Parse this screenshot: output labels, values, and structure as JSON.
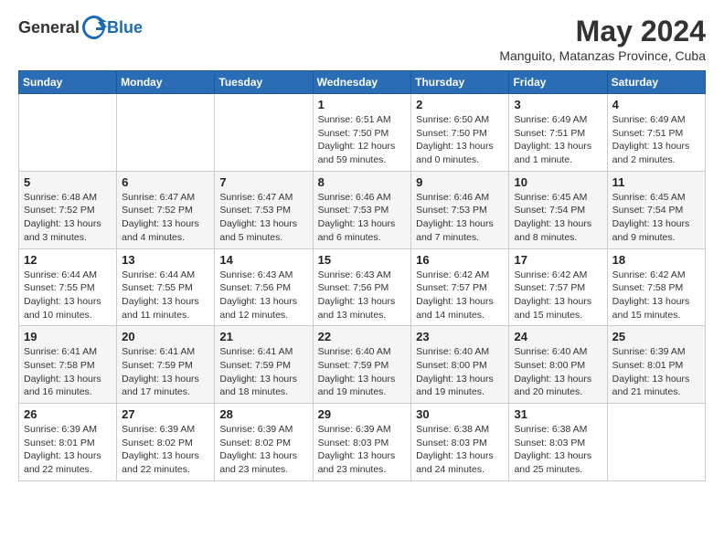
{
  "header": {
    "logo_general": "General",
    "logo_blue": "Blue",
    "month_title": "May 2024",
    "location": "Manguito, Matanzas Province, Cuba"
  },
  "weekdays": [
    "Sunday",
    "Monday",
    "Tuesday",
    "Wednesday",
    "Thursday",
    "Friday",
    "Saturday"
  ],
  "weeks": [
    [
      {
        "day": "",
        "info": ""
      },
      {
        "day": "",
        "info": ""
      },
      {
        "day": "",
        "info": ""
      },
      {
        "day": "1",
        "info": "Sunrise: 6:51 AM\nSunset: 7:50 PM\nDaylight: 12 hours and 59 minutes."
      },
      {
        "day": "2",
        "info": "Sunrise: 6:50 AM\nSunset: 7:50 PM\nDaylight: 13 hours and 0 minutes."
      },
      {
        "day": "3",
        "info": "Sunrise: 6:49 AM\nSunset: 7:51 PM\nDaylight: 13 hours and 1 minute."
      },
      {
        "day": "4",
        "info": "Sunrise: 6:49 AM\nSunset: 7:51 PM\nDaylight: 13 hours and 2 minutes."
      }
    ],
    [
      {
        "day": "5",
        "info": "Sunrise: 6:48 AM\nSunset: 7:52 PM\nDaylight: 13 hours and 3 minutes."
      },
      {
        "day": "6",
        "info": "Sunrise: 6:47 AM\nSunset: 7:52 PM\nDaylight: 13 hours and 4 minutes."
      },
      {
        "day": "7",
        "info": "Sunrise: 6:47 AM\nSunset: 7:53 PM\nDaylight: 13 hours and 5 minutes."
      },
      {
        "day": "8",
        "info": "Sunrise: 6:46 AM\nSunset: 7:53 PM\nDaylight: 13 hours and 6 minutes."
      },
      {
        "day": "9",
        "info": "Sunrise: 6:46 AM\nSunset: 7:53 PM\nDaylight: 13 hours and 7 minutes."
      },
      {
        "day": "10",
        "info": "Sunrise: 6:45 AM\nSunset: 7:54 PM\nDaylight: 13 hours and 8 minutes."
      },
      {
        "day": "11",
        "info": "Sunrise: 6:45 AM\nSunset: 7:54 PM\nDaylight: 13 hours and 9 minutes."
      }
    ],
    [
      {
        "day": "12",
        "info": "Sunrise: 6:44 AM\nSunset: 7:55 PM\nDaylight: 13 hours and 10 minutes."
      },
      {
        "day": "13",
        "info": "Sunrise: 6:44 AM\nSunset: 7:55 PM\nDaylight: 13 hours and 11 minutes."
      },
      {
        "day": "14",
        "info": "Sunrise: 6:43 AM\nSunset: 7:56 PM\nDaylight: 13 hours and 12 minutes."
      },
      {
        "day": "15",
        "info": "Sunrise: 6:43 AM\nSunset: 7:56 PM\nDaylight: 13 hours and 13 minutes."
      },
      {
        "day": "16",
        "info": "Sunrise: 6:42 AM\nSunset: 7:57 PM\nDaylight: 13 hours and 14 minutes."
      },
      {
        "day": "17",
        "info": "Sunrise: 6:42 AM\nSunset: 7:57 PM\nDaylight: 13 hours and 15 minutes."
      },
      {
        "day": "18",
        "info": "Sunrise: 6:42 AM\nSunset: 7:58 PM\nDaylight: 13 hours and 15 minutes."
      }
    ],
    [
      {
        "day": "19",
        "info": "Sunrise: 6:41 AM\nSunset: 7:58 PM\nDaylight: 13 hours and 16 minutes."
      },
      {
        "day": "20",
        "info": "Sunrise: 6:41 AM\nSunset: 7:59 PM\nDaylight: 13 hours and 17 minutes."
      },
      {
        "day": "21",
        "info": "Sunrise: 6:41 AM\nSunset: 7:59 PM\nDaylight: 13 hours and 18 minutes."
      },
      {
        "day": "22",
        "info": "Sunrise: 6:40 AM\nSunset: 7:59 PM\nDaylight: 13 hours and 19 minutes."
      },
      {
        "day": "23",
        "info": "Sunrise: 6:40 AM\nSunset: 8:00 PM\nDaylight: 13 hours and 19 minutes."
      },
      {
        "day": "24",
        "info": "Sunrise: 6:40 AM\nSunset: 8:00 PM\nDaylight: 13 hours and 20 minutes."
      },
      {
        "day": "25",
        "info": "Sunrise: 6:39 AM\nSunset: 8:01 PM\nDaylight: 13 hours and 21 minutes."
      }
    ],
    [
      {
        "day": "26",
        "info": "Sunrise: 6:39 AM\nSunset: 8:01 PM\nDaylight: 13 hours and 22 minutes."
      },
      {
        "day": "27",
        "info": "Sunrise: 6:39 AM\nSunset: 8:02 PM\nDaylight: 13 hours and 22 minutes."
      },
      {
        "day": "28",
        "info": "Sunrise: 6:39 AM\nSunset: 8:02 PM\nDaylight: 13 hours and 23 minutes."
      },
      {
        "day": "29",
        "info": "Sunrise: 6:39 AM\nSunset: 8:03 PM\nDaylight: 13 hours and 23 minutes."
      },
      {
        "day": "30",
        "info": "Sunrise: 6:38 AM\nSunset: 8:03 PM\nDaylight: 13 hours and 24 minutes."
      },
      {
        "day": "31",
        "info": "Sunrise: 6:38 AM\nSunset: 8:03 PM\nDaylight: 13 hours and 25 minutes."
      },
      {
        "day": "",
        "info": ""
      }
    ]
  ]
}
